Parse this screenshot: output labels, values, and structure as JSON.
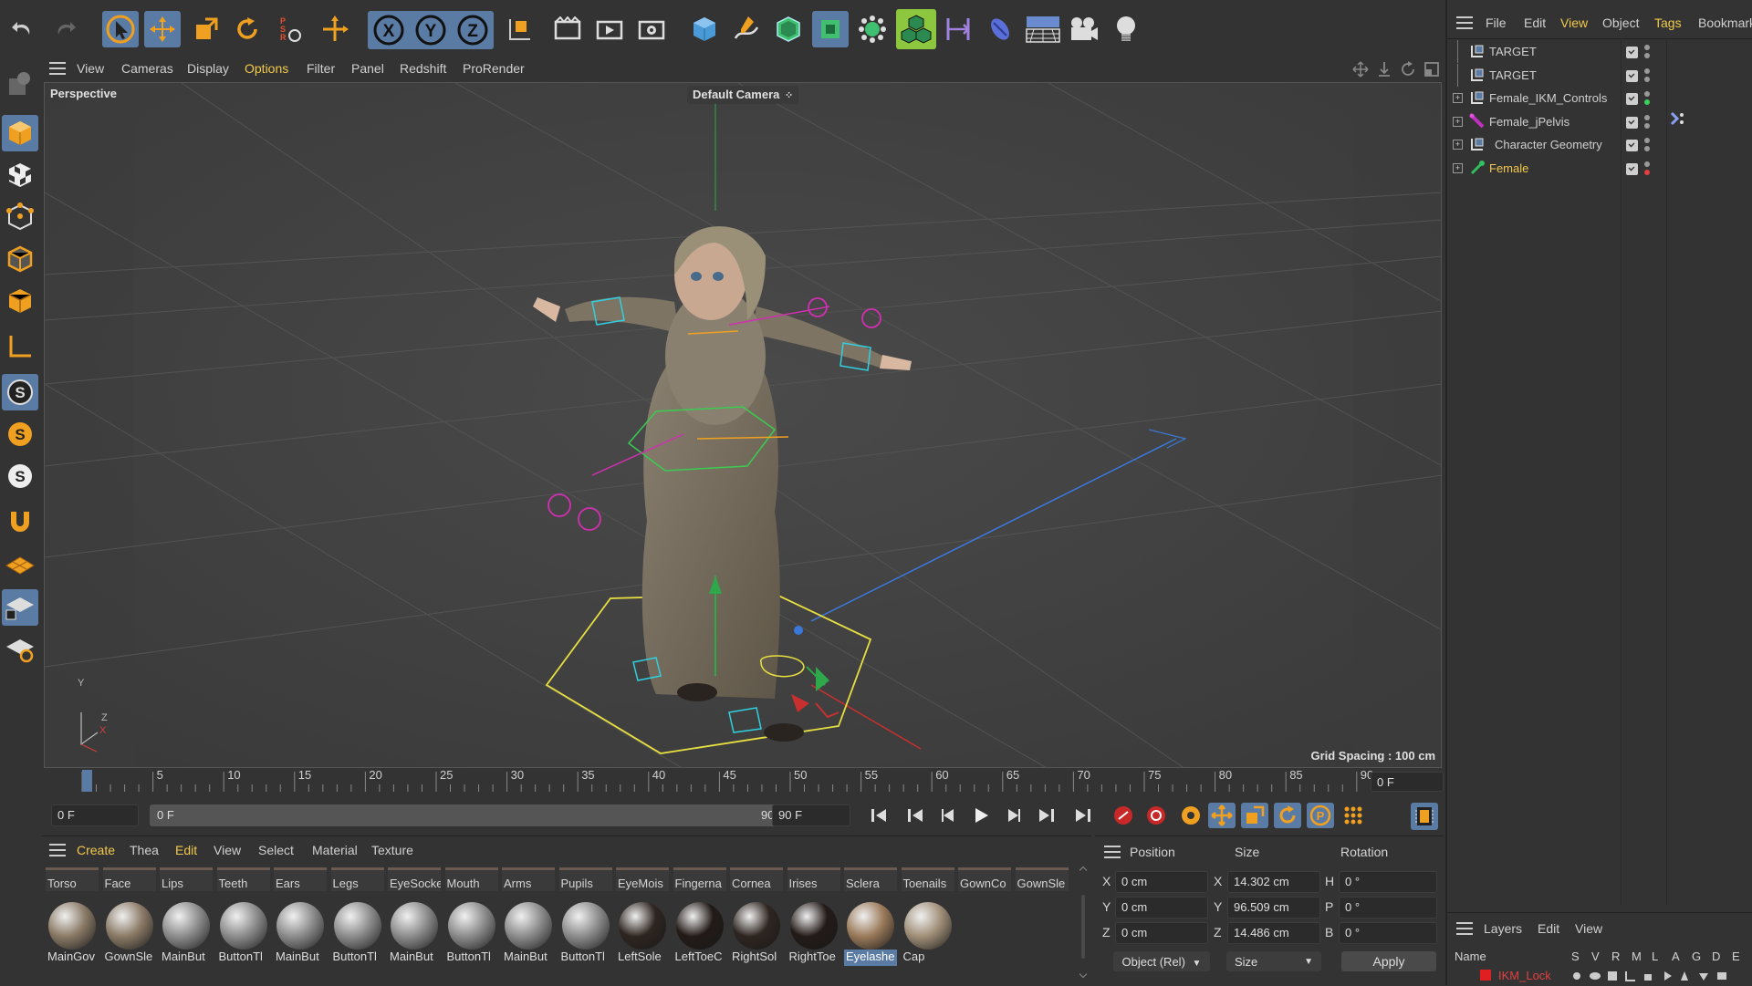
{
  "top_menu": {
    "items": [
      "File",
      "Edit",
      "View",
      "Object",
      "Tags",
      "Bookmark"
    ],
    "active": "View"
  },
  "viewport_menu": {
    "items": [
      "View",
      "Cameras",
      "Display",
      "Options",
      "Filter",
      "Panel",
      "Redshift",
      "ProRender"
    ],
    "active": "Options"
  },
  "viewport": {
    "projection_label": "Perspective",
    "camera_label": "Default Camera",
    "grid_spacing": "Grid Spacing : 100 cm",
    "axis_labels": {
      "y": "Y",
      "z": "Z",
      "x": "X"
    }
  },
  "objects": [
    {
      "name": "TARGET",
      "icon": "null-object-icon",
      "color": "#d0d0d0",
      "expand": false,
      "dot2": "#9a9a9a"
    },
    {
      "name": "TARGET",
      "icon": "null-object-icon",
      "color": "#d0d0d0",
      "expand": false,
      "dot2": "#9a9a9a"
    },
    {
      "name": "Female_IKM_Controls",
      "icon": "null-object-icon",
      "color": "#d0d0d0",
      "expand": true,
      "dot2": "#3ccf5a"
    },
    {
      "name": "Female_jPelvis",
      "icon": "joint-icon",
      "color": "#d0d0d0",
      "expand": true,
      "dot2": "#9a9a9a"
    },
    {
      "name": "Character Geometry",
      "icon": "null-object-icon",
      "color": "#d0d0d0",
      "expand": true,
      "dot2": "#9a9a9a"
    },
    {
      "name": "Female",
      "icon": "character-icon",
      "color": "#f2c94c",
      "expand": true,
      "dot2": "#e04040"
    }
  ],
  "timeline": {
    "ticks": [
      "0",
      "5",
      "10",
      "15",
      "20",
      "25",
      "30",
      "35",
      "40",
      "45",
      "50",
      "55",
      "60",
      "65",
      "70",
      "75",
      "80",
      "85",
      "90"
    ],
    "current_frame": "0 F",
    "start_frame": "0 F",
    "range_start": "0 F",
    "range_end": "90 F",
    "end_frame": "90 F"
  },
  "material_menu": {
    "items": [
      "Create",
      "Thea",
      "Edit",
      "View",
      "Select",
      "Material",
      "Texture"
    ],
    "active": [
      "Create",
      "Edit"
    ]
  },
  "material_tabs": [
    "Torso",
    "Face",
    "Lips",
    "Teeth",
    "Ears",
    "Legs",
    "EyeSocke",
    "Mouth",
    "Arms",
    "Pupils",
    "EyeMois",
    "Fingerna",
    "Cornea",
    "Irises",
    "Sclera",
    "Toenails",
    "GownCo",
    "GownSle"
  ],
  "materials": [
    {
      "name": "MainGov",
      "tone": "#8a7a66"
    },
    {
      "name": "GownSle",
      "tone": "#8a7a66"
    },
    {
      "name": "MainBut",
      "tone": "#8c8c8c"
    },
    {
      "name": "ButtonTl",
      "tone": "#8c8c8c"
    },
    {
      "name": "MainBut",
      "tone": "#8c8c8c"
    },
    {
      "name": "ButtonTl",
      "tone": "#8c8c8c"
    },
    {
      "name": "MainBut",
      "tone": "#8c8c8c"
    },
    {
      "name": "ButtonTl",
      "tone": "#8c8c8c"
    },
    {
      "name": "MainBut",
      "tone": "#8c8c8c"
    },
    {
      "name": "ButtonTl",
      "tone": "#8c8c8c"
    },
    {
      "name": "LeftSole",
      "tone": "#2e2520"
    },
    {
      "name": "LeftToeC",
      "tone": "#221a17"
    },
    {
      "name": "RightSol",
      "tone": "#2e2520"
    },
    {
      "name": "RightToe",
      "tone": "#221a17"
    },
    {
      "name": "Eyelashe",
      "tone": "#9a7a5a",
      "selected": true
    },
    {
      "name": "Cap",
      "tone": "#a08f78"
    }
  ],
  "coords": {
    "headers": {
      "position": "Position",
      "size": "Size",
      "rotation": "Rotation"
    },
    "rows": [
      {
        "axis": "X",
        "pos": "0 cm",
        "size_axis": "X",
        "size": "14.302 cm",
        "rot_axis": "H",
        "rot": "0 °"
      },
      {
        "axis": "Y",
        "pos": "0 cm",
        "size_axis": "Y",
        "size": "96.509 cm",
        "rot_axis": "P",
        "rot": "0 °"
      },
      {
        "axis": "Z",
        "pos": "0 cm",
        "size_axis": "Z",
        "size": "14.486 cm",
        "rot_axis": "B",
        "rot": "0 °"
      }
    ],
    "mode_select": "Object (Rel)",
    "size_select": "Size",
    "apply_label": "Apply"
  },
  "layers": {
    "menu": [
      "Layers",
      "Edit",
      "View"
    ],
    "col_name": "Name",
    "flags": [
      "S",
      "V",
      "R",
      "M",
      "L",
      "A",
      "G",
      "D",
      "E"
    ],
    "row_name": "IKM_Lock",
    "row_color": "#e02020"
  },
  "colors": {
    "accent": "#5a7ba3",
    "active_text": "#f2c94c",
    "panel": "#333333",
    "viewport": "#3b3b3b"
  }
}
